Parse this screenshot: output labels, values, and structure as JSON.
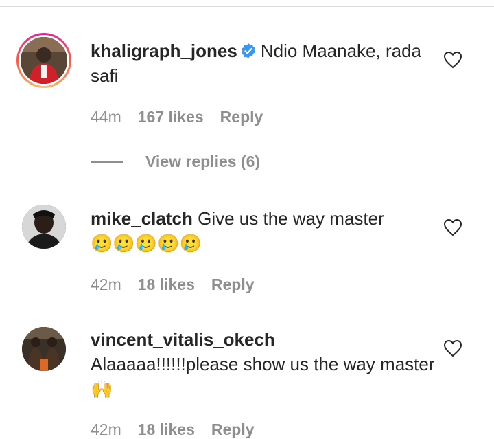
{
  "comments": [
    {
      "username": "khaligraph_jones",
      "verified": true,
      "text": "Ndio Maanake, rada safi",
      "time": "44m",
      "likes": "167 likes",
      "reply": "Reply",
      "story_ring": true
    },
    {
      "username": "mike_clatch",
      "verified": false,
      "text": "Give us the way master",
      "emojis": "🥲🥲🥲🥲🥲",
      "time": "42m",
      "likes": "18 likes",
      "reply": "Reply",
      "story_ring": false
    },
    {
      "username": "vincent_vitalis_okech",
      "verified": false,
      "text": "Alaaaaa!!!!!!please show us the way master",
      "emojis": "🙌",
      "time": "42m",
      "likes": "18 likes",
      "reply": "Reply",
      "story_ring": false
    }
  ],
  "view_replies": "View replies (6)",
  "colors": {
    "text": "#262626",
    "muted": "#8e8e8e",
    "verified": "#3897f0"
  }
}
